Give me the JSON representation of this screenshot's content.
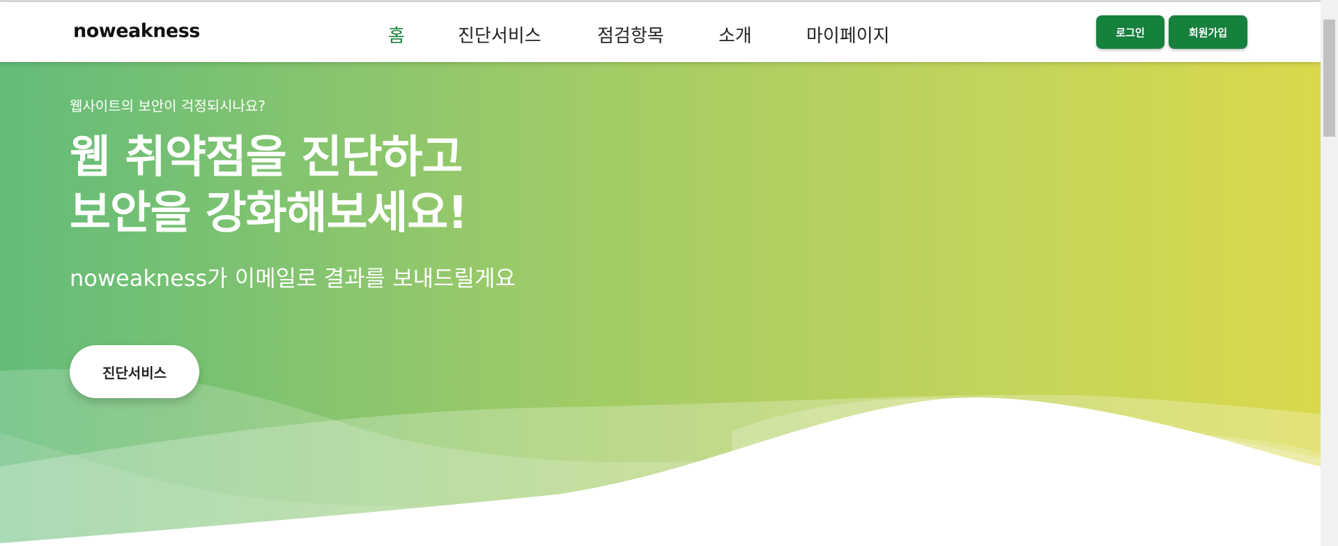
{
  "header": {
    "logo": "noweakness",
    "nav": [
      {
        "label": "홈",
        "active": true
      },
      {
        "label": "진단서비스",
        "active": false
      },
      {
        "label": "점검항목",
        "active": false
      },
      {
        "label": "소개",
        "active": false
      },
      {
        "label": "마이페이지",
        "active": false
      }
    ],
    "login_label": "로그인",
    "signup_label": "회원가입"
  },
  "hero": {
    "eyebrow": "웹사이트의 보안이 걱정되시나요?",
    "headline_line1": "웹 취약점을 진단하고",
    "headline_line2": "보안을 강화해보세요!",
    "subline": "noweakness가 이메일로 결과를 보내드릴게요",
    "cta_label": "진단서비스"
  },
  "colors": {
    "brand_green": "#16803d",
    "active_nav": "#1a7f3a",
    "gradient_start": "#63bc79",
    "gradient_end": "#dad94c"
  }
}
